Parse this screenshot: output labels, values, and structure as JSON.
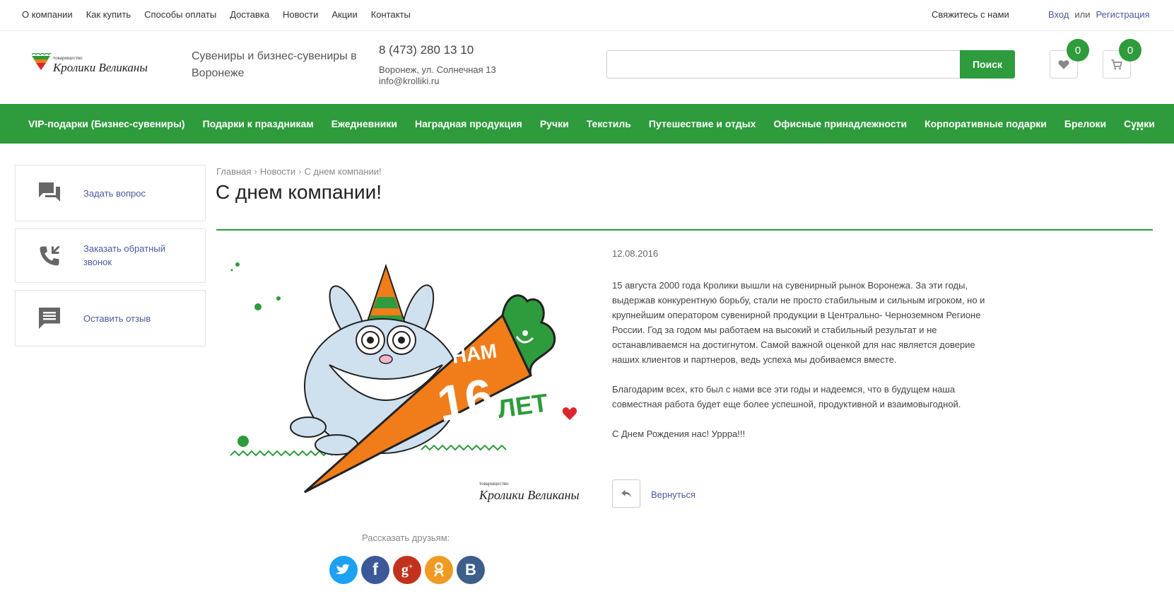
{
  "topnav": [
    "О компании",
    "Как купить",
    "Способы оплаты",
    "Доставка",
    "Новости",
    "Акции",
    "Контакты"
  ],
  "contact_us": "Свяжитесь с нами",
  "auth": {
    "login": "Вход",
    "or": "или",
    "register": "Регистрация"
  },
  "logo": {
    "top_text": "товарищество",
    "main_text": "Кролики Великаны"
  },
  "header": {
    "slogan": "Сувениры и бизнес-сувениры в Воронеже",
    "phone": "8 (473) 280 13 10",
    "address": "Воронеж, ул. Солнечная 13",
    "email": "info@krolliki.ru"
  },
  "search": {
    "placeholder": "",
    "button": "Поиск"
  },
  "favorites": {
    "icon": "heart-icon",
    "count": "0"
  },
  "cart": {
    "icon": "cart-icon",
    "count": "0"
  },
  "catnav": [
    "VIP-подарки (Бизнес-сувениры)",
    "Подарки к праздникам",
    "Ежедневники",
    "Наградная продукция",
    "Ручки",
    "Текстиль",
    "Путешествие и отдых",
    "Офисные принадлежности",
    "Корпоративные подарки",
    "Брелоки",
    "Сумки"
  ],
  "catnav_more": "...",
  "sidebar": [
    {
      "label": "Задать вопрос",
      "icon": "chat-icon"
    },
    {
      "label": "Заказать обратный звонок",
      "icon": "phone-callback-icon"
    },
    {
      "label": "Оставить отзыв",
      "icon": "feedback-icon"
    }
  ],
  "breadcrumb": [
    "Главная",
    "Новости",
    "С днем компании!"
  ],
  "title": "С днем компании!",
  "picture": {
    "line1": "НАМ",
    "number": "16",
    "line2": "ЛЕТ"
  },
  "date": "12.08.2016",
  "article": [
    "15 августа 2000 года Кролики вышли на сувенирный рынок Воронежа. За эти годы, выдержав конкурентную борьбу, стали не просто стабильным и сильным игроком, но и крупнейшим оператором сувенирной продукции в Центрально- Черноземном Регионе России. Год за годом мы работаем на высокий и стабильный результат и не останавливаемся на достигнутом. Самой важной оценкой для нас является доверие наших клиентов и партнеров, ведь успеха мы добиваемся вместе.",
    "Благодарим всех, кто был с нами все эти годы и надеемся, что в будущем наша совместная работа будет еще более успешной, продуктивной и взаимовыгодной.",
    "С Днем Рождения нас! Уррра!!!"
  ],
  "back_label": "Вернуться",
  "share_label": "Рассказать друзьям:",
  "social": [
    {
      "name": "twitter",
      "color": "#1da1f2"
    },
    {
      "name": "facebook",
      "color": "#3b5998"
    },
    {
      "name": "google-plus",
      "color": "#c1321d"
    },
    {
      "name": "odnoklassniki",
      "color": "#f09a21"
    },
    {
      "name": "vkontakte",
      "color": "#3e5e8c"
    }
  ],
  "colors": {
    "brand_green": "#2e9b3c",
    "link": "#4a5aa0",
    "carrot": "#f07d1a"
  }
}
